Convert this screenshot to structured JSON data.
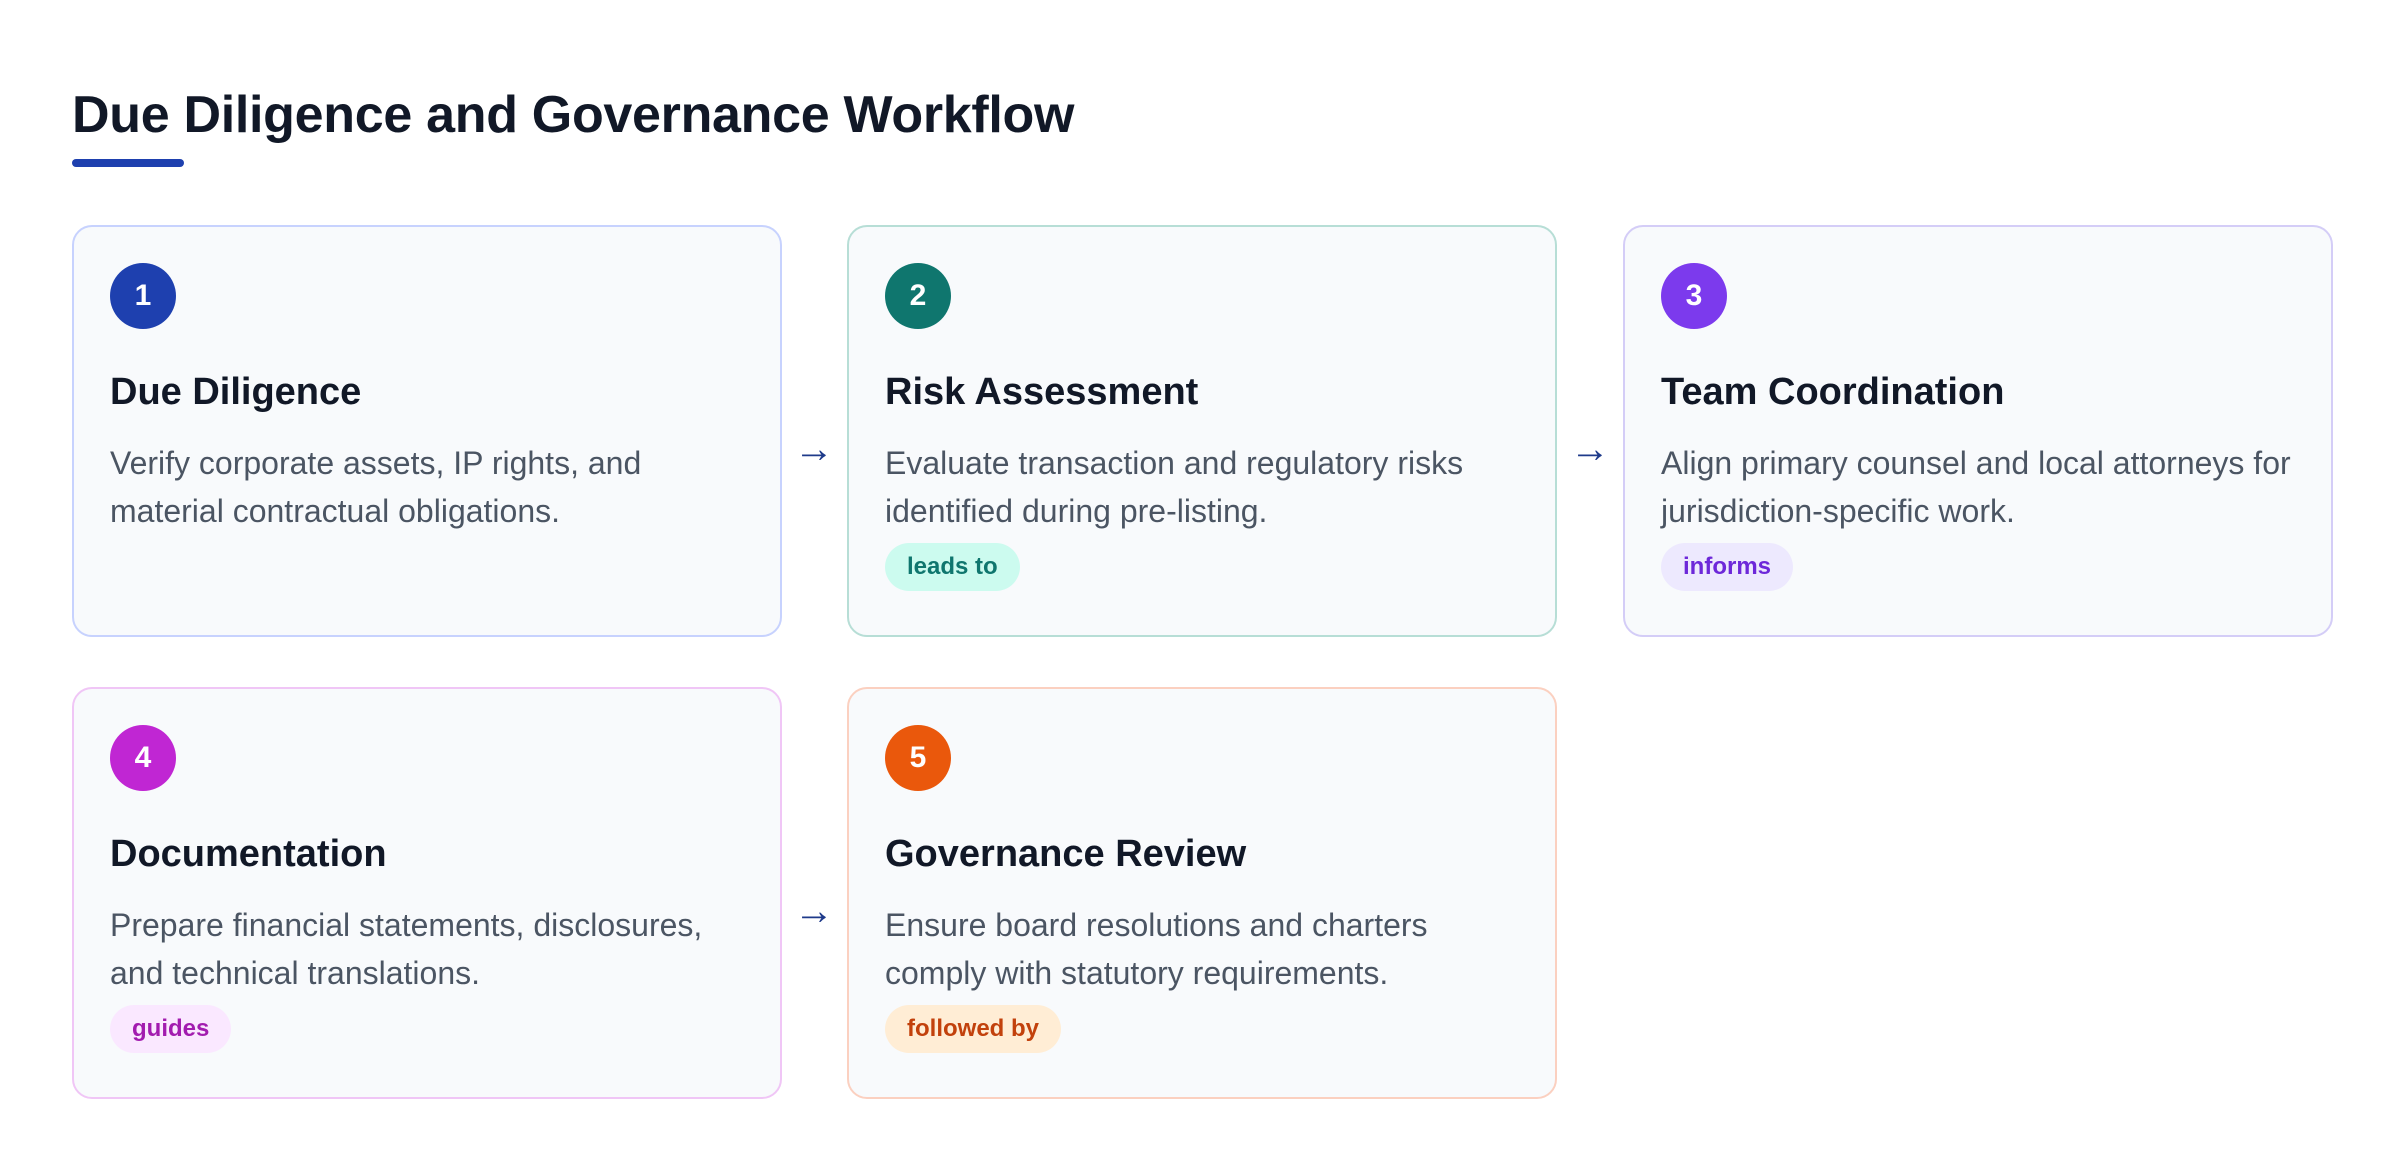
{
  "title": "Due Diligence and Governance Workflow",
  "colors": {
    "accent": "#1e40af"
  },
  "steps": [
    {
      "number": "1",
      "title": "Due Diligence",
      "description": "Verify corporate assets, IP rights, and material contractual obligations.",
      "tag": "",
      "color": "#1e40af"
    },
    {
      "number": "2",
      "title": "Risk Assessment",
      "description": "Evaluate transaction and regulatory risks identified during pre-listing.",
      "tag": "leads to",
      "color": "#0f766e"
    },
    {
      "number": "3",
      "title": "Team Coordination",
      "description": "Align primary counsel and local attorneys for jurisdiction-specific work.",
      "tag": "informs",
      "color": "#7c3aed"
    },
    {
      "number": "4",
      "title": "Documentation",
      "description": "Prepare financial statements, disclosures, and technical translations.",
      "tag": "guides",
      "color": "#c026d3"
    },
    {
      "number": "5",
      "title": "Governance Review",
      "description": "Ensure board resolutions and charters comply with statutory requirements.",
      "tag": "followed by",
      "color": "#ea580c"
    }
  ],
  "arrows": [
    "→",
    "→",
    "→"
  ]
}
